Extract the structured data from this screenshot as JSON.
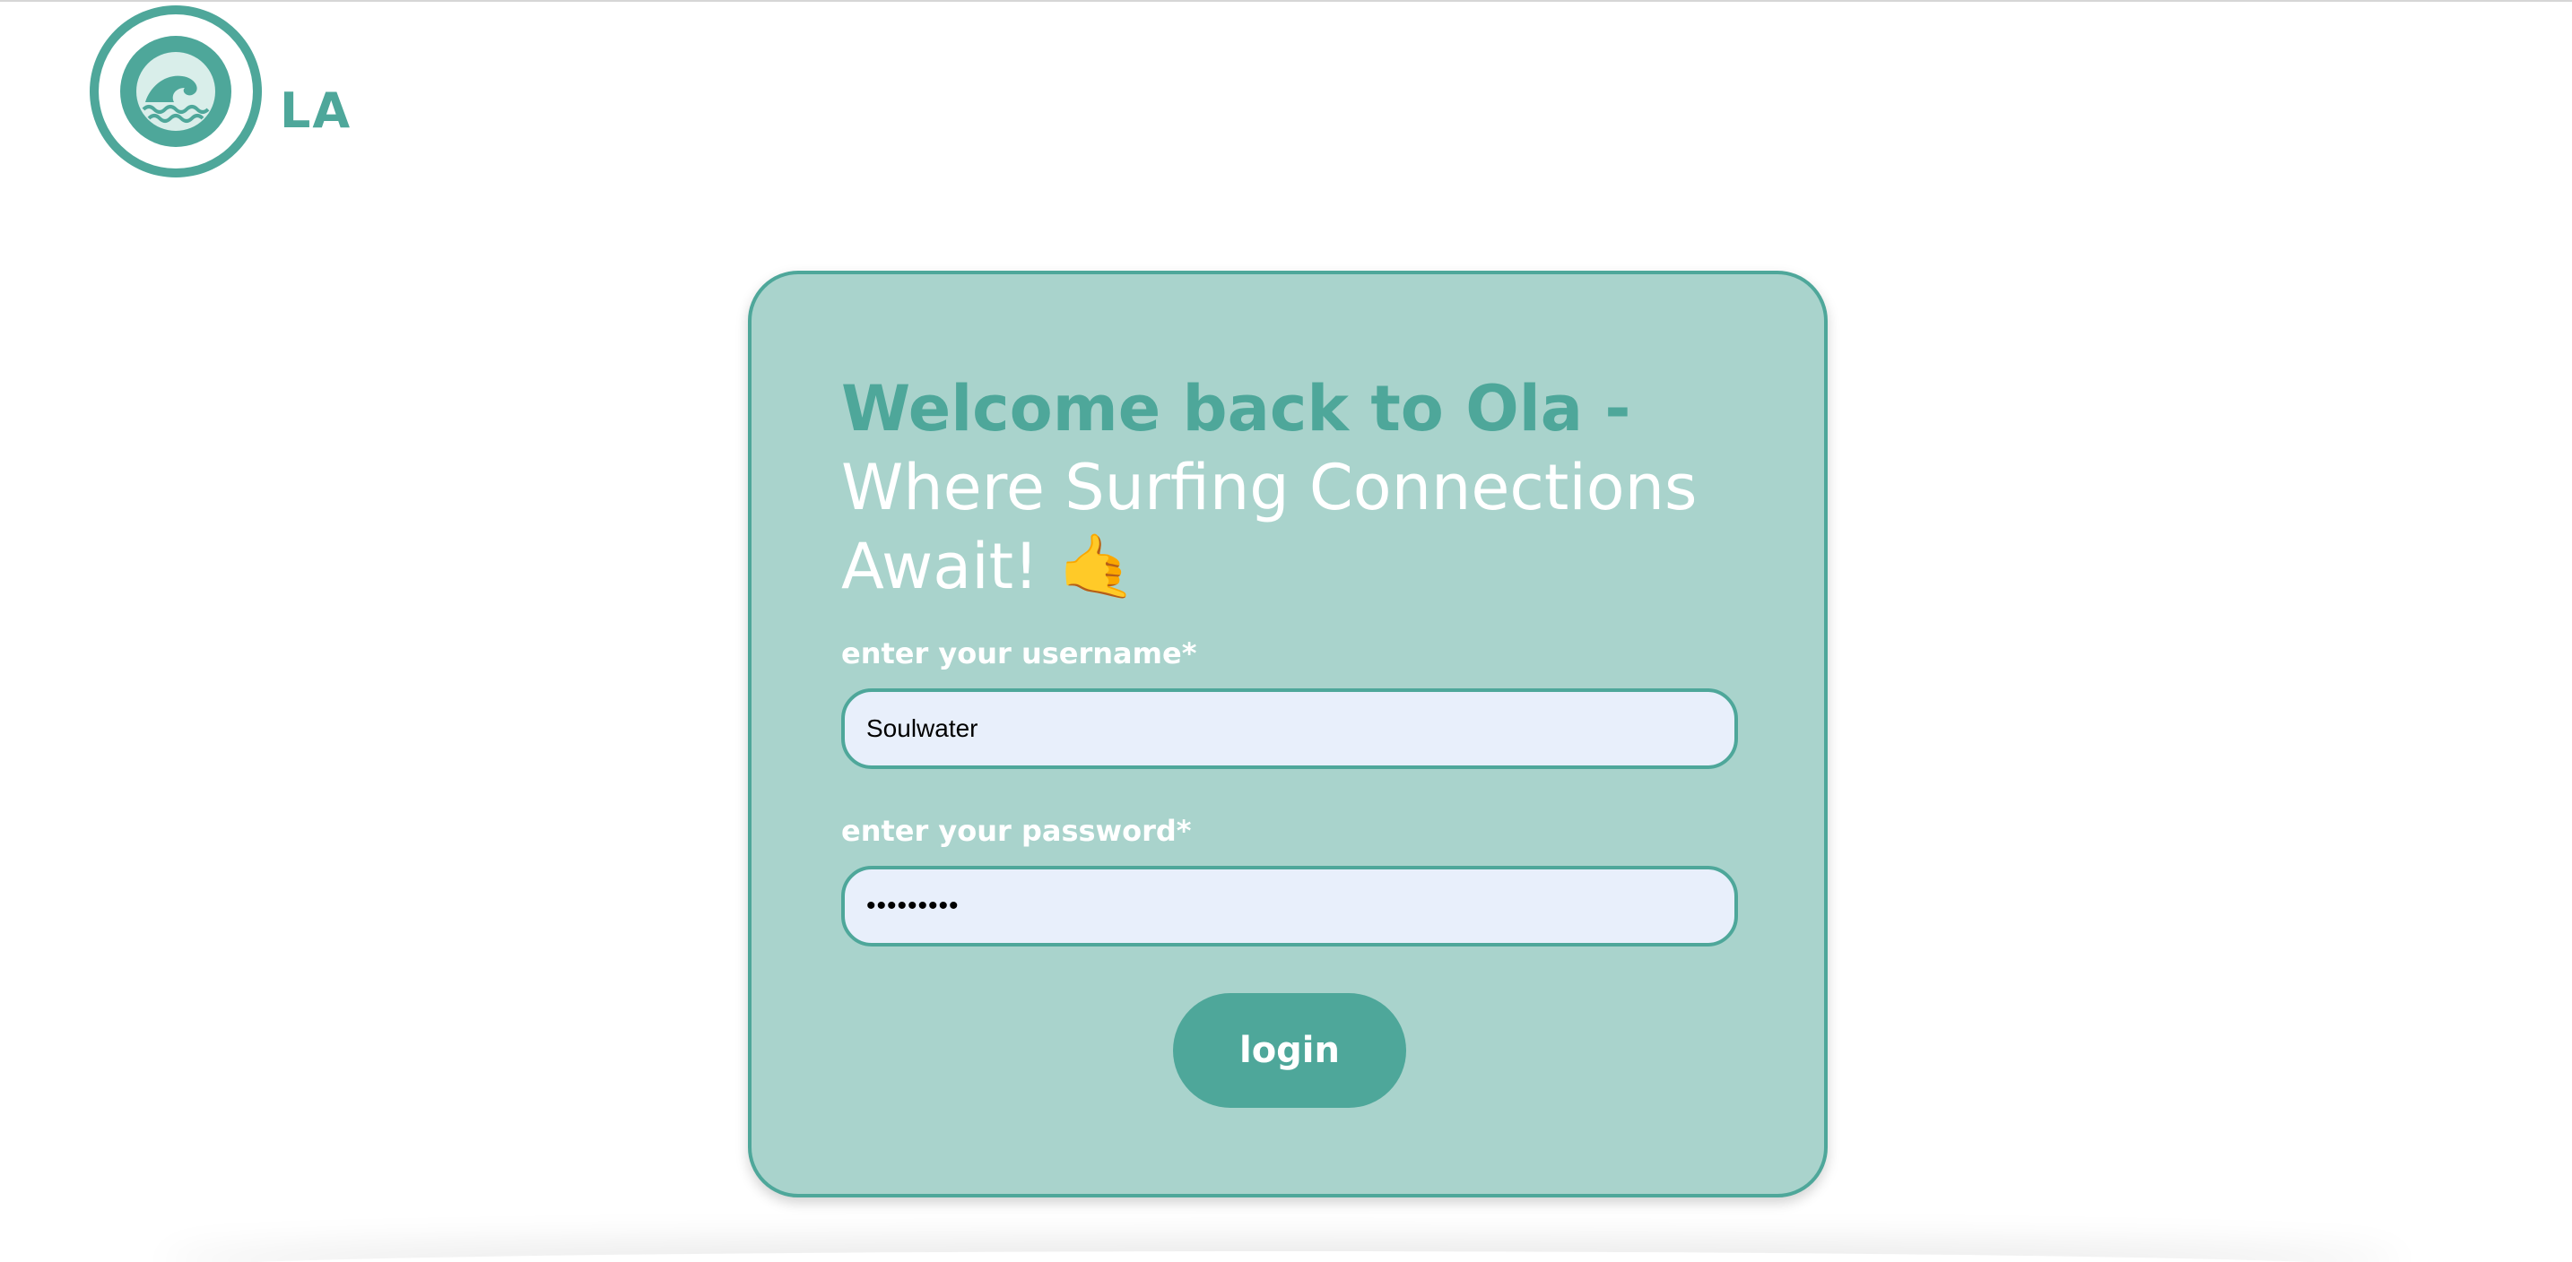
{
  "brand": {
    "logo_text": "LA",
    "logo_icon": "wave-icon",
    "color": "#4ea79a"
  },
  "login_card": {
    "title_strong": "Welcome back to Ola -",
    "title_rest": "Where Surfing Connections Await!",
    "title_emoji": "🤙",
    "username_label": "enter your username*",
    "username_value": "Soulwater",
    "password_label": "enter your password*",
    "password_value": "•••••••••",
    "login_label": "login",
    "card_color": "#a9d3cc",
    "input_color": "#e8effb"
  }
}
